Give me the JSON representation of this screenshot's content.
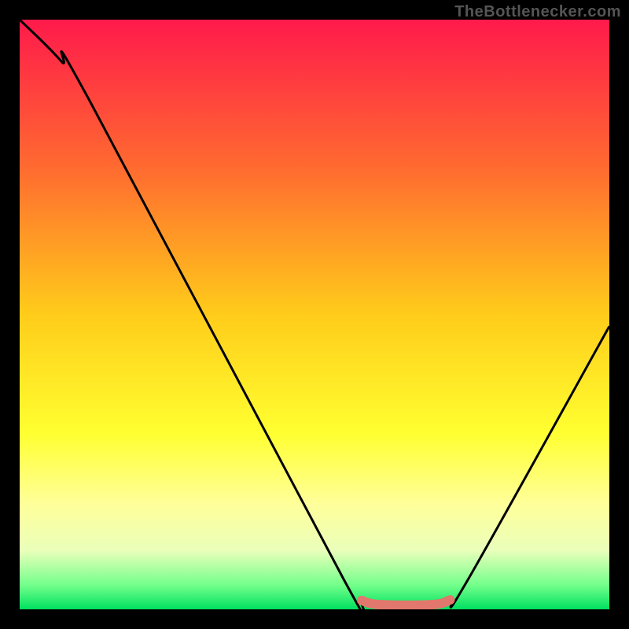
{
  "watermark": "TheBottlenecker.com",
  "chart_data": {
    "type": "line",
    "title": "",
    "xlabel": "",
    "ylabel": "",
    "xlim": [
      0,
      100
    ],
    "ylim": [
      0,
      100
    ],
    "gradient_stops": [
      {
        "offset": 0,
        "color": "#ff1a4b"
      },
      {
        "offset": 25,
        "color": "#ff6a30"
      },
      {
        "offset": 50,
        "color": "#ffcc1a"
      },
      {
        "offset": 70,
        "color": "#ffff30"
      },
      {
        "offset": 82,
        "color": "#ffff99"
      },
      {
        "offset": 90,
        "color": "#eaffba"
      },
      {
        "offset": 96,
        "color": "#70ff8a"
      },
      {
        "offset": 100,
        "color": "#00e060"
      }
    ],
    "series": [
      {
        "name": "bottleneck-curve",
        "color": "#000000",
        "points": [
          {
            "x": 0,
            "y": 100
          },
          {
            "x": 7,
            "y": 93
          },
          {
            "x": 12,
            "y": 86
          },
          {
            "x": 55,
            "y": 5
          },
          {
            "x": 58,
            "y": 1.5
          },
          {
            "x": 61,
            "y": 0.8
          },
          {
            "x": 70,
            "y": 0.8
          },
          {
            "x": 73,
            "y": 1.5
          },
          {
            "x": 76,
            "y": 5
          },
          {
            "x": 100,
            "y": 48
          }
        ]
      },
      {
        "name": "sweet-spot",
        "color": "#e2776d",
        "points": [
          {
            "x": 58,
            "y": 1.5
          },
          {
            "x": 61,
            "y": 0.8
          },
          {
            "x": 70,
            "y": 0.8
          },
          {
            "x": 73,
            "y": 1.6
          }
        ]
      }
    ]
  }
}
